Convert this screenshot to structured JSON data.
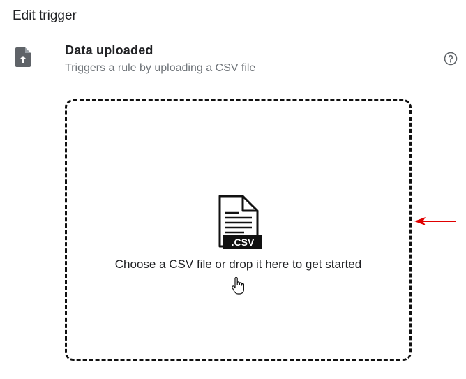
{
  "header": {
    "title": "Edit trigger"
  },
  "trigger": {
    "name": "Data uploaded",
    "description": "Triggers a rule by uploading a CSV file",
    "icon": "file-upload-icon",
    "help_icon": "help-circle-icon"
  },
  "dropzone": {
    "prompt": "Choose a CSV file or drop it here to get started",
    "file_badge": ".CSV",
    "icon": "csv-file-icon"
  },
  "annotation": {
    "icon": "red-arrow-icon",
    "color": "#e00000"
  }
}
